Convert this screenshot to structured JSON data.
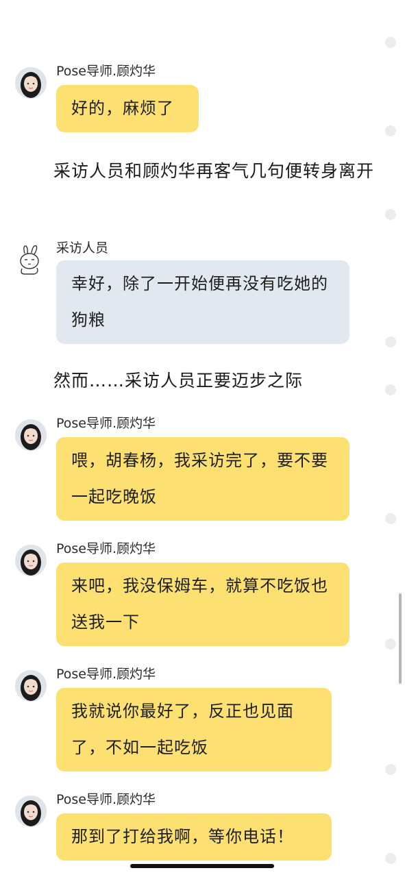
{
  "messages": [
    {
      "speaker": "Pose导师.顾灼华",
      "text": "好的，麻烦了"
    },
    {
      "narration": "采访人员和顾灼华再客气几句便转身离开"
    },
    {
      "speaker": "采访人员",
      "text": "幸好，除了一开始便再没有吃她的狗粮"
    },
    {
      "narration": "然而……采访人员正要迈步之际"
    },
    {
      "speaker": "Pose导师.顾灼华",
      "text": "喂，胡春杨，我采访完了，要不要一起吃晚饭"
    },
    {
      "speaker": "Pose导师.顾灼华",
      "text": "来吧，我没保姆车，就算不吃饭也送我一下"
    },
    {
      "speaker": "Pose导师.顾灼华",
      "text": "我就说你最好了，反正也见面了，不如一起吃饭"
    },
    {
      "speaker": "Pose导师.顾灼华",
      "text": "那到了打给我啊，等你电话！"
    }
  ],
  "colors": {
    "bubble_main": "#fde072",
    "bubble_other": "#e2e8f0",
    "background": "#ffffff"
  },
  "icons": {
    "main_avatar": "girl-avatar-icon",
    "other_avatar": "bunny-sketch-icon"
  }
}
